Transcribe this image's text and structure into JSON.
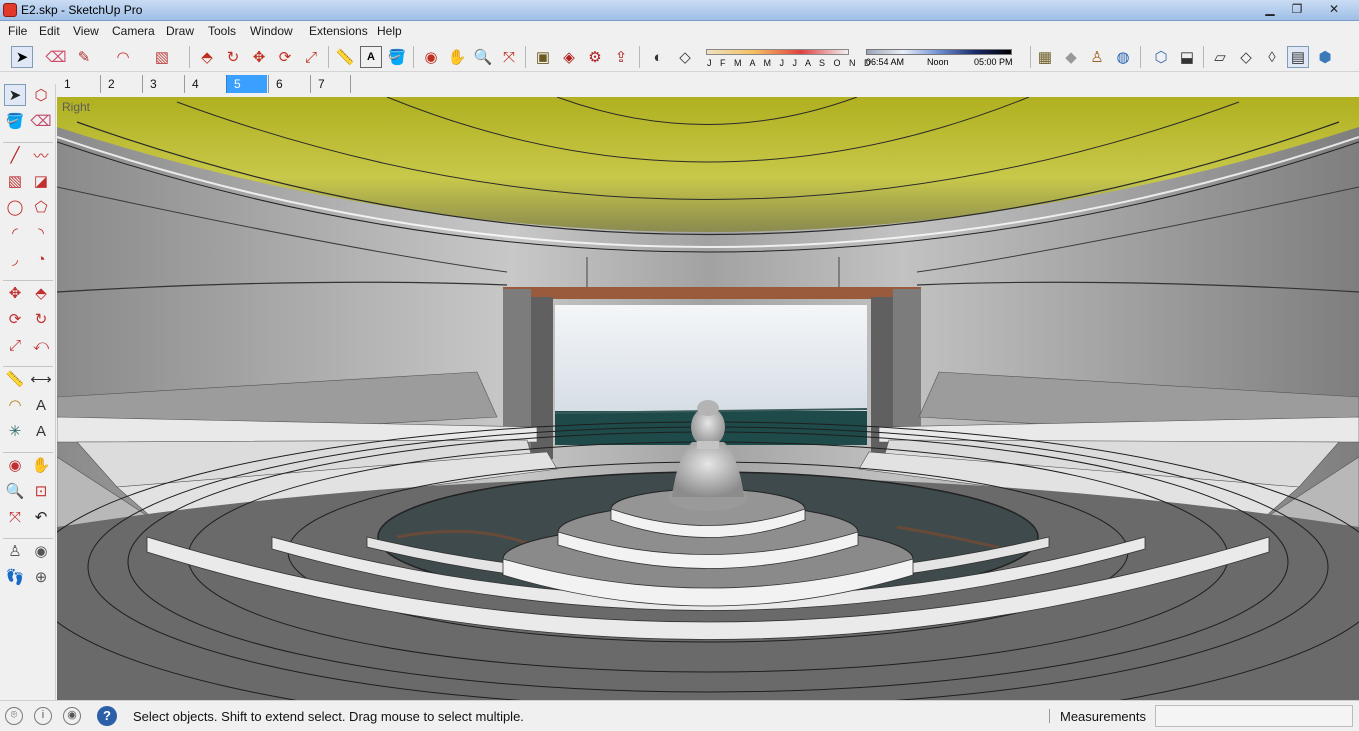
{
  "window": {
    "title": "E2.skp - SketchUp Pro",
    "minimize": "▁",
    "maximize": "❐",
    "close": "✕"
  },
  "menu": [
    "File",
    "Edit",
    "View",
    "Camera",
    "Draw",
    "Tools",
    "Window",
    "Extensions",
    "Help"
  ],
  "toolbar": {
    "icons": [
      {
        "name": "select-icon",
        "glyph": "➤",
        "selected": true
      },
      {
        "name": "eraser-icon",
        "glyph": "⌫"
      },
      {
        "name": "pencil-icon",
        "glyph": "✎"
      },
      {
        "name": "arc-icon",
        "glyph": "◠"
      },
      {
        "name": "rectangle-icon",
        "glyph": "▧"
      },
      {
        "name": "push-pull-icon",
        "glyph": "⬘"
      },
      {
        "name": "follow-me-icon",
        "glyph": "↻"
      },
      {
        "name": "move-icon",
        "glyph": "✥"
      },
      {
        "name": "rotate-icon",
        "glyph": "⟳"
      },
      {
        "name": "scale-icon",
        "glyph": "⤢"
      },
      {
        "name": "tape-measure-icon",
        "glyph": "📏"
      },
      {
        "name": "text-icon",
        "glyph": "A"
      },
      {
        "name": "paint-bucket-icon",
        "glyph": "🪣"
      },
      {
        "name": "orbit-icon",
        "glyph": "◉"
      },
      {
        "name": "pan-icon",
        "glyph": "✋"
      },
      {
        "name": "zoom-icon",
        "glyph": "🔍"
      },
      {
        "name": "zoom-extents-icon",
        "glyph": "⤧"
      },
      {
        "name": "warehouse-icon",
        "glyph": "▣"
      },
      {
        "name": "components-icon",
        "glyph": "◈"
      },
      {
        "name": "extension-warehouse-icon",
        "glyph": "⚙"
      },
      {
        "name": "share-model-icon",
        "glyph": "⇪"
      },
      {
        "name": "shadows-icon",
        "glyph": "◐"
      },
      {
        "name": "fog-icon",
        "glyph": "◇"
      }
    ],
    "months_label": "J F M A M J J A S O N D",
    "time_start": "06:54 AM",
    "time_mid": "Noon",
    "time_end": "05:00 PM",
    "right_icons": [
      {
        "name": "geo-location-icon",
        "glyph": "▦"
      },
      {
        "name": "sandbox-icon",
        "glyph": "◆"
      },
      {
        "name": "walk-icon",
        "glyph": "♙"
      },
      {
        "name": "globe-icon",
        "glyph": "◍"
      },
      {
        "name": "iso-view-icon",
        "glyph": "⬡"
      },
      {
        "name": "top-view-icon",
        "glyph": "⬓"
      },
      {
        "name": "xray-style-icon",
        "glyph": "▱"
      },
      {
        "name": "wireframe-style-icon",
        "glyph": "◇"
      },
      {
        "name": "hidden-line-style-icon",
        "glyph": "◊"
      },
      {
        "name": "shaded-style-icon",
        "glyph": "◆"
      },
      {
        "name": "shaded-textures-style-icon",
        "glyph": "▤",
        "selected": true
      },
      {
        "name": "monochrome-style-icon",
        "glyph": "⬢"
      }
    ]
  },
  "scenes": {
    "tabs": [
      "1",
      "2",
      "3",
      "4",
      "5",
      "6",
      "7"
    ],
    "active": "5"
  },
  "left_tools": [
    {
      "name": "select-tool-icon",
      "glyph": "➤",
      "selected": true
    },
    {
      "name": "make-component-icon",
      "glyph": "⬡"
    },
    {
      "name": "paint-tool-icon",
      "glyph": "🪣"
    },
    {
      "name": "eraser-tool-icon",
      "glyph": "⌫"
    },
    {
      "name": "line-tool-icon",
      "glyph": "╱"
    },
    {
      "name": "freehand-tool-icon",
      "glyph": "〰"
    },
    {
      "name": "rectangle-tool-icon",
      "glyph": "▧"
    },
    {
      "name": "rotated-rectangle-icon",
      "glyph": "◪"
    },
    {
      "name": "circle-tool-icon",
      "glyph": "◯"
    },
    {
      "name": "polygon-tool-icon",
      "glyph": "⬠"
    },
    {
      "name": "arc-tool-icon",
      "glyph": "◜"
    },
    {
      "name": "two-point-arc-icon",
      "glyph": "◝"
    },
    {
      "name": "three-point-arc-icon",
      "glyph": "◞"
    },
    {
      "name": "pie-tool-icon",
      "glyph": "◔"
    },
    {
      "name": "move-tool-icon",
      "glyph": "✥"
    },
    {
      "name": "push-pull-tool-icon",
      "glyph": "⬘"
    },
    {
      "name": "rotate-tool-icon",
      "glyph": "⟳"
    },
    {
      "name": "follow-me-tool-icon",
      "glyph": "↻"
    },
    {
      "name": "scale-tool-icon",
      "glyph": "⤢"
    },
    {
      "name": "offset-tool-icon",
      "glyph": "⤺"
    },
    {
      "name": "tape-measure-tool-icon",
      "glyph": "📏"
    },
    {
      "name": "dimension-tool-icon",
      "glyph": "⟷"
    },
    {
      "name": "protractor-tool-icon",
      "glyph": "◠"
    },
    {
      "name": "text-tool-icon",
      "glyph": "A"
    },
    {
      "name": "axes-tool-icon",
      "glyph": "✳"
    },
    {
      "name": "3d-text-tool-icon",
      "glyph": "A"
    },
    {
      "name": "orbit-tool-icon",
      "glyph": "◉"
    },
    {
      "name": "pan-tool-icon",
      "glyph": "✋"
    },
    {
      "name": "zoom-tool-icon",
      "glyph": "🔍"
    },
    {
      "name": "zoom-window-icon",
      "glyph": "⊡"
    },
    {
      "name": "zoom-extents-tool-icon",
      "glyph": "⤧"
    },
    {
      "name": "previous-view-icon",
      "glyph": "↶"
    },
    {
      "name": "position-camera-icon",
      "glyph": "♙"
    },
    {
      "name": "look-around-icon",
      "glyph": "◉"
    },
    {
      "name": "walk-tool-icon",
      "glyph": "👣"
    },
    {
      "name": "section-plane-icon",
      "glyph": "⊕"
    }
  ],
  "viewport": {
    "view_name": "Right"
  },
  "status": {
    "icons": [
      "geo-location-status-icon",
      "credits-icon",
      "user-icon"
    ],
    "help": "?",
    "text": "Select objects. Shift to extend select. Drag mouse to select multiple.",
    "measurements_label": "Measurements",
    "measurements_value": ""
  },
  "colors": {
    "ceiling": "#c8c828",
    "wall": "#a9a9a9",
    "floor": "#5f5f5f",
    "sky": "#e4ecf2",
    "water": "#1e4a4a",
    "scene_tab_active": "#3aa0ff"
  }
}
